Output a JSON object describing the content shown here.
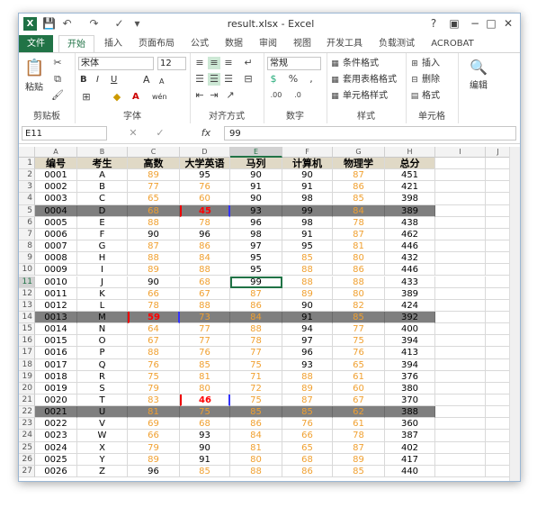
{
  "window": {
    "title": "result.xlsx - Excel",
    "app_icon": "X",
    "help": "?",
    "controls": [
      "−",
      "□",
      "✕"
    ]
  },
  "tabs": [
    "文件",
    "开始",
    "插入",
    "页面布局",
    "公式",
    "数据",
    "审阅",
    "视图",
    "开发工具",
    "负载测试",
    "ACROBAT"
  ],
  "ribbon": {
    "clipboard": {
      "label": "剪贴板",
      "paste": "粘贴"
    },
    "font": {
      "label": "字体",
      "name": "宋体",
      "size": "12",
      "bold": "B",
      "italic": "I",
      "underline": "U",
      "grow": "A",
      "shrink": "A",
      "wen": "wén"
    },
    "align": {
      "label": "对齐方式"
    },
    "number": {
      "label": "数字",
      "format": "常规"
    },
    "styles": {
      "label": "样式",
      "cond": "条件格式",
      "table": "套用表格格式",
      "cell": "单元格样式"
    },
    "cells": {
      "label": "单元格",
      "insert": "插入",
      "delete": "删除",
      "format": "格式"
    },
    "editing": {
      "label": "编辑"
    }
  },
  "formula": {
    "namebox": "E11",
    "fx": "fx",
    "value": "99"
  },
  "columns": [
    "A",
    "B",
    "C",
    "D",
    "E",
    "F",
    "G",
    "H",
    "I",
    "J"
  ],
  "selected_cell": {
    "col": "E",
    "row": 11
  },
  "colors": {
    "orange": "#f0a030",
    "highlight_row": "#7f7f7f",
    "fail_red": "#ff0000",
    "excel_green": "#217346"
  },
  "headers": [
    "编号",
    "考生",
    "高数",
    "大学英语",
    "马列",
    "计算机",
    "物理学",
    "总分"
  ],
  "rows": [
    [
      "0001",
      "A",
      "89",
      "95",
      "90",
      "90",
      "87",
      "451"
    ],
    [
      "0002",
      "B",
      "77",
      "76",
      "91",
      "91",
      "86",
      "421"
    ],
    [
      "0003",
      "C",
      "65",
      "60",
      "90",
      "98",
      "85",
      "398"
    ],
    [
      "0004",
      "D",
      "68",
      "45",
      "93",
      "99",
      "84",
      "389"
    ],
    [
      "0005",
      "E",
      "88",
      "78",
      "96",
      "98",
      "78",
      "438"
    ],
    [
      "0006",
      "F",
      "90",
      "96",
      "98",
      "91",
      "87",
      "462"
    ],
    [
      "0007",
      "G",
      "87",
      "86",
      "97",
      "95",
      "81",
      "446"
    ],
    [
      "0008",
      "H",
      "88",
      "84",
      "95",
      "85",
      "80",
      "432"
    ],
    [
      "0009",
      "I",
      "89",
      "88",
      "95",
      "88",
      "86",
      "446"
    ],
    [
      "0010",
      "J",
      "90",
      "68",
      "99",
      "88",
      "88",
      "433"
    ],
    [
      "0011",
      "K",
      "66",
      "67",
      "87",
      "89",
      "80",
      "389"
    ],
    [
      "0012",
      "L",
      "78",
      "88",
      "86",
      "90",
      "82",
      "424"
    ],
    [
      "0013",
      "M",
      "59",
      "73",
      "84",
      "91",
      "85",
      "392"
    ],
    [
      "0014",
      "N",
      "64",
      "77",
      "88",
      "94",
      "77",
      "400"
    ],
    [
      "0015",
      "O",
      "67",
      "77",
      "78",
      "97",
      "75",
      "394"
    ],
    [
      "0016",
      "P",
      "88",
      "76",
      "77",
      "96",
      "76",
      "413"
    ],
    [
      "0017",
      "Q",
      "76",
      "85",
      "75",
      "93",
      "65",
      "394"
    ],
    [
      "0018",
      "R",
      "75",
      "81",
      "71",
      "88",
      "61",
      "376"
    ],
    [
      "0019",
      "S",
      "79",
      "80",
      "72",
      "89",
      "60",
      "380"
    ],
    [
      "0020",
      "T",
      "83",
      "46",
      "75",
      "87",
      "67",
      "370"
    ],
    [
      "0021",
      "U",
      "81",
      "75",
      "85",
      "85",
      "62",
      "388"
    ],
    [
      "0022",
      "V",
      "69",
      "68",
      "86",
      "76",
      "61",
      "360"
    ],
    [
      "0023",
      "W",
      "66",
      "93",
      "84",
      "66",
      "78",
      "387"
    ],
    [
      "0024",
      "X",
      "79",
      "90",
      "81",
      "65",
      "87",
      "402"
    ],
    [
      "0025",
      "Y",
      "89",
      "91",
      "80",
      "68",
      "89",
      "417"
    ],
    [
      "0026",
      "Z",
      "96",
      "85",
      "88",
      "86",
      "85",
      "440"
    ]
  ],
  "highlight_rows": [
    4,
    13,
    21
  ],
  "fail_cells": [
    {
      "row": 5,
      "col": "D"
    },
    {
      "row": 14,
      "col": "C"
    },
    {
      "row": 21,
      "col": "D"
    }
  ]
}
